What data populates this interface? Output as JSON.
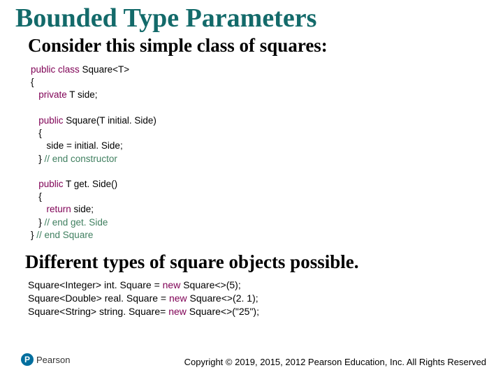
{
  "title": "Bounded Type Parameters",
  "subtitle1": "Consider this simple class of squares:",
  "code1": {
    "l01a": "public",
    "l01b": " class",
    "l01c": " Square<T>",
    "l02": "{",
    "l03a": "   private",
    "l03b": " T side;",
    "l04": "",
    "l05a": "   public",
    "l05b": " Square(T initial. Side)",
    "l06": "   {",
    "l07": "      side = initial. Side;",
    "l08a": "   } ",
    "l08b": "// end constructor",
    "l09": "",
    "l10a": "   public",
    "l10b": " T get. Side()",
    "l11": "   {",
    "l12a": "      return",
    "l12b": " side;",
    "l13a": "   } ",
    "l13b": "// end get. Side",
    "l14a": "} ",
    "l14b": "// end Square"
  },
  "subtitle2": "Different types of square objects possible.",
  "code2": {
    "l1a": "Square<Integer> int. Square = ",
    "l1b": "new",
    "l1c": " Square<>(5);",
    "l2a": "Square<Double> real. Square = ",
    "l2b": "new",
    "l2c": " Square<>(2. 1);",
    "l3a": "Square<String> string. Square= ",
    "l3b": "new",
    "l3c": " Square<>(\"25\");"
  },
  "logo": {
    "initial": "P",
    "brand": "Pearson"
  },
  "copyright": "Copyright © 2019, 2015, 2012 Pearson Education, Inc. All Rights Reserved"
}
